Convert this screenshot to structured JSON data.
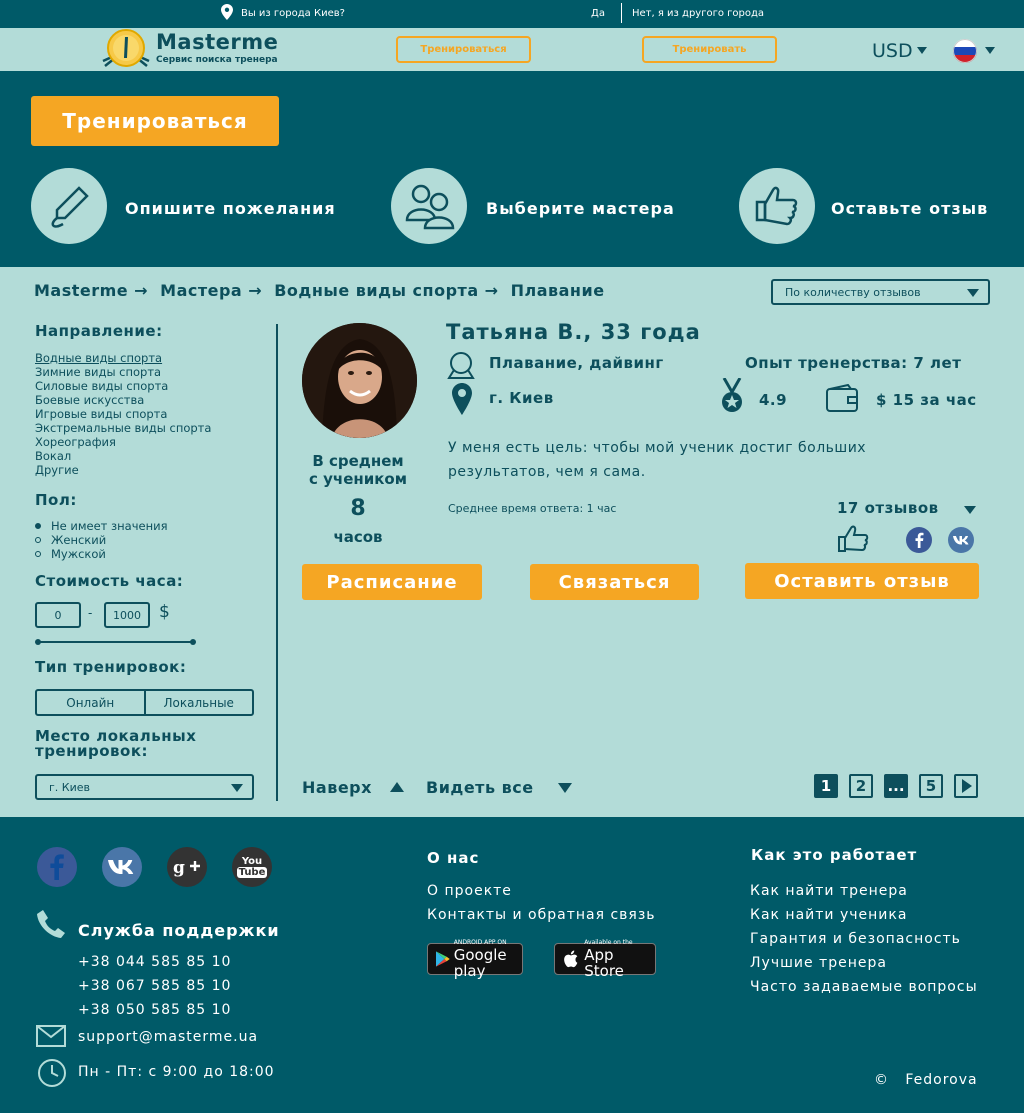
{
  "topbar": {
    "question": "Вы из города Киев?",
    "yes": "Да",
    "no": "Нет, я из другого города"
  },
  "header": {
    "logo_title": "Masterme",
    "logo_subtitle": "Сервис поиска тренера",
    "btn_train": "Тренироваться",
    "btn_coach": "Тренировать",
    "currency": "USD"
  },
  "hero": {
    "cta": "Тренироваться",
    "steps": [
      "Опишите пожелания",
      "Выберите мастера",
      "Оставьте отзыв"
    ]
  },
  "breadcrumb": [
    "Masterme",
    "Мастера",
    "Водные виды спорта",
    "Плавание"
  ],
  "breadcrumb_sep": "→",
  "sort": {
    "selected": "По количеству отзывов"
  },
  "sidebar": {
    "direction_title": "Направление:",
    "directions": [
      "Водные виды спорта",
      "Зимние виды спорта",
      "Силовые виды спорта",
      "Боевые искусства",
      "Игровые виды спорта",
      "Экстремальные виды спорта",
      "Хореография",
      "Вокал",
      "Другие"
    ],
    "gender_title": "Пол:",
    "genders": [
      "Не имеет значения",
      "Женский",
      "Мужской"
    ],
    "gender_selected": 0,
    "price_title": "Стоимость часа:",
    "price_min": "0",
    "price_dash": "-",
    "price_max": "1000",
    "price_currency": "$",
    "type_title": "Тип тренировок:",
    "types": [
      "Онлайн",
      "Локальные"
    ],
    "place_title_1": "Место локальных",
    "place_title_2": "тренировок:",
    "city": "г. Киев"
  },
  "trainer": {
    "name": "Татьяна В., 33 года",
    "sport": "Плавание, дайвинг",
    "experience": "Опыт тренерства: 7 лет",
    "city": "г. Киев",
    "rating": "4.9",
    "price": "$ 15 за час",
    "description": "У меня есть цель: чтобы мой ученик достиг больших результатов, чем я сама.",
    "response_time": "Среднее время ответа: 1 час",
    "reviews": "17 отзывов",
    "avg_line1": "В среднем",
    "avg_line2": "с учеником",
    "avg_hours": "8",
    "avg_unit": "часов",
    "btn_schedule": "Расписание",
    "btn_contact": "Связаться",
    "btn_review": "Оставить отзыв"
  },
  "nav": {
    "up": "Наверх",
    "see_all": "Видеть все"
  },
  "pagination": [
    "1",
    "2",
    "...",
    "5"
  ],
  "footer": {
    "support_title": "Служба поддержки",
    "phones": [
      "+38 044 585 85 10",
      "+38 067 585 85 10",
      "+38 050 585 85 10"
    ],
    "email": "support@masterme.ua",
    "hours": "Пн - Пт: с  9:00 до 18:00",
    "about_title": "О нас",
    "about_links": [
      "О проекте",
      "Контакты и обратная связь"
    ],
    "how_title": "Как это работает",
    "how_links": [
      "Как найти тренера",
      "Как найти ученика",
      "Гарантия и безопасность",
      "Лучшие тренера",
      "Часто задаваемые вопросы"
    ],
    "google_small": "ANDROID APP ON",
    "google_big": "Google play",
    "apple_small": "Available on the",
    "apple_big": "App Store",
    "copyright_symbol": "©",
    "copyright": "Fedorova",
    "youtube_top": "You",
    "youtube_bottom": "Tube"
  },
  "colors": {
    "dark_teal": "#005a68",
    "light_teal": "#b3dcd8",
    "orange": "#f5a623",
    "text": "#0d4f5c"
  }
}
